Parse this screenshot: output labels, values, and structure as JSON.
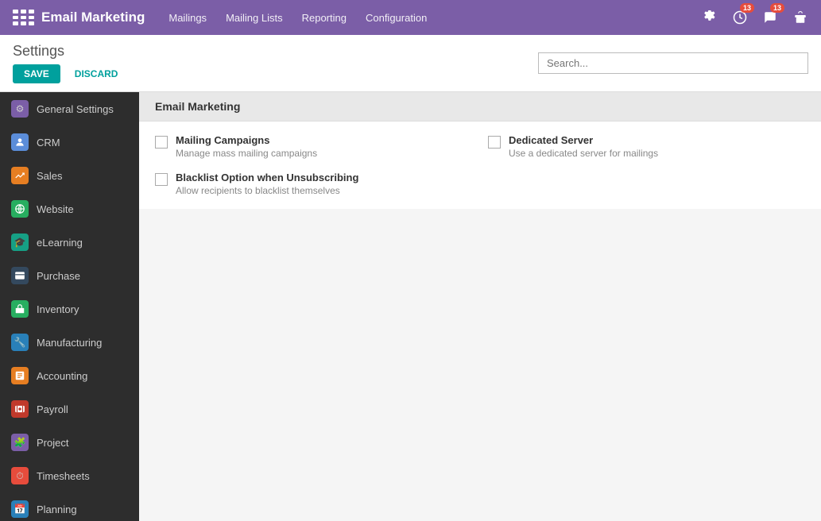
{
  "topnav": {
    "title": "Email Marketing",
    "links": [
      "Mailings",
      "Mailing Lists",
      "Reporting",
      "Configuration"
    ],
    "badge1": "13",
    "badge2": "13"
  },
  "toolbar": {
    "settings_label": "Settings",
    "save_label": "SAVE",
    "discard_label": "DISCARD",
    "search_placeholder": "Search..."
  },
  "sidebar": {
    "items": [
      {
        "id": "general-settings",
        "label": "General Settings",
        "color": "#7b5ea7",
        "icon": "⚙"
      },
      {
        "id": "crm",
        "label": "CRM",
        "color": "#5b8dd9",
        "icon": "👁"
      },
      {
        "id": "sales",
        "label": "Sales",
        "color": "#e67e22",
        "icon": "📈"
      },
      {
        "id": "website",
        "label": "Website",
        "color": "#27ae60",
        "icon": "🌐"
      },
      {
        "id": "elearning",
        "label": "eLearning",
        "color": "#16a085",
        "icon": "🎓"
      },
      {
        "id": "purchase",
        "label": "Purchase",
        "color": "#2c3e50",
        "icon": "📋"
      },
      {
        "id": "inventory",
        "label": "Inventory",
        "color": "#27ae60",
        "icon": "📦"
      },
      {
        "id": "manufacturing",
        "label": "Manufacturing",
        "color": "#2980b9",
        "icon": "🔧"
      },
      {
        "id": "accounting",
        "label": "Accounting",
        "color": "#e67e22",
        "icon": "📊"
      },
      {
        "id": "payroll",
        "label": "Payroll",
        "color": "#c0392b",
        "icon": "💳"
      },
      {
        "id": "project",
        "label": "Project",
        "color": "#7b5ea7",
        "icon": "🧩"
      },
      {
        "id": "timesheets",
        "label": "Timesheets",
        "color": "#e74c3c",
        "icon": "⏱"
      },
      {
        "id": "planning",
        "label": "Planning",
        "color": "#2980b9",
        "icon": "📅"
      }
    ]
  },
  "content": {
    "section_title": "Email Marketing",
    "settings": [
      {
        "id": "mailing-campaigns",
        "label": "Mailing Campaigns",
        "desc": "Manage mass mailing campaigns",
        "checked": false
      },
      {
        "id": "dedicated-server",
        "label": "Dedicated Server",
        "desc": "Use a dedicated server for mailings",
        "checked": false
      },
      {
        "id": "blacklist-option",
        "label": "Blacklist Option when Unsubscribing",
        "desc": "Allow recipients to blacklist themselves",
        "checked": false
      }
    ]
  },
  "icons": {
    "grid": "⊞",
    "gear": "⚙",
    "clock": "⏱",
    "chat": "💬",
    "gift": "🎁"
  }
}
